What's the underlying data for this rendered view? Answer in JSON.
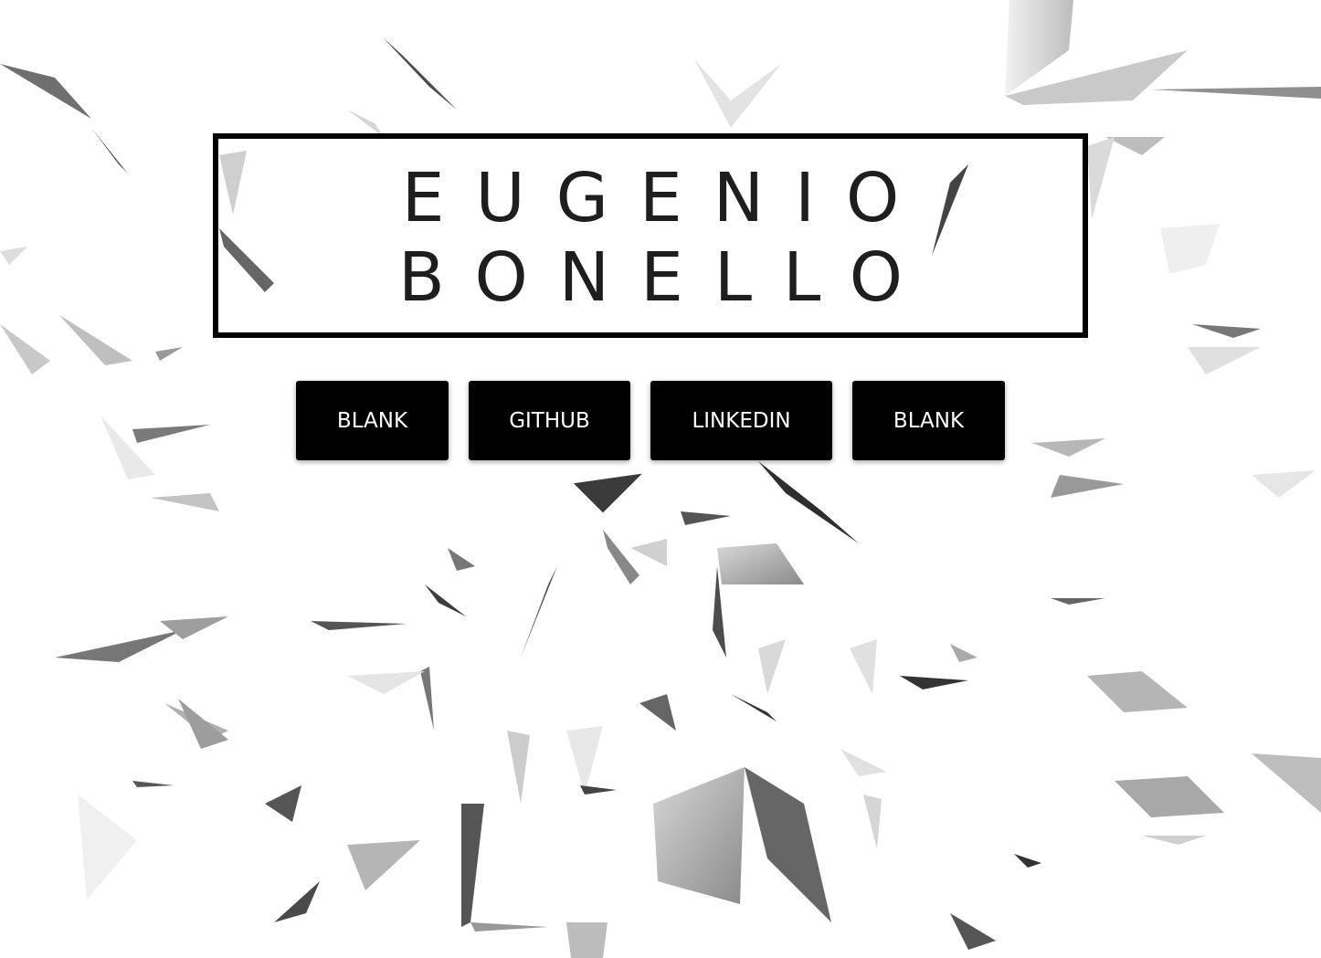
{
  "header": {
    "name_line1": "EUGENIO",
    "name_line2": "BONELLO"
  },
  "nav": {
    "buttons": [
      {
        "label": "BLANK"
      },
      {
        "label": "GITHUB"
      },
      {
        "label": "LINKEDIN"
      },
      {
        "label": "BLANK"
      }
    ]
  },
  "colors": {
    "background": "#ffffff",
    "title_text": "#1e1e1e",
    "title_border": "#000000",
    "button_bg": "#000000",
    "button_text": "#ffffff"
  }
}
